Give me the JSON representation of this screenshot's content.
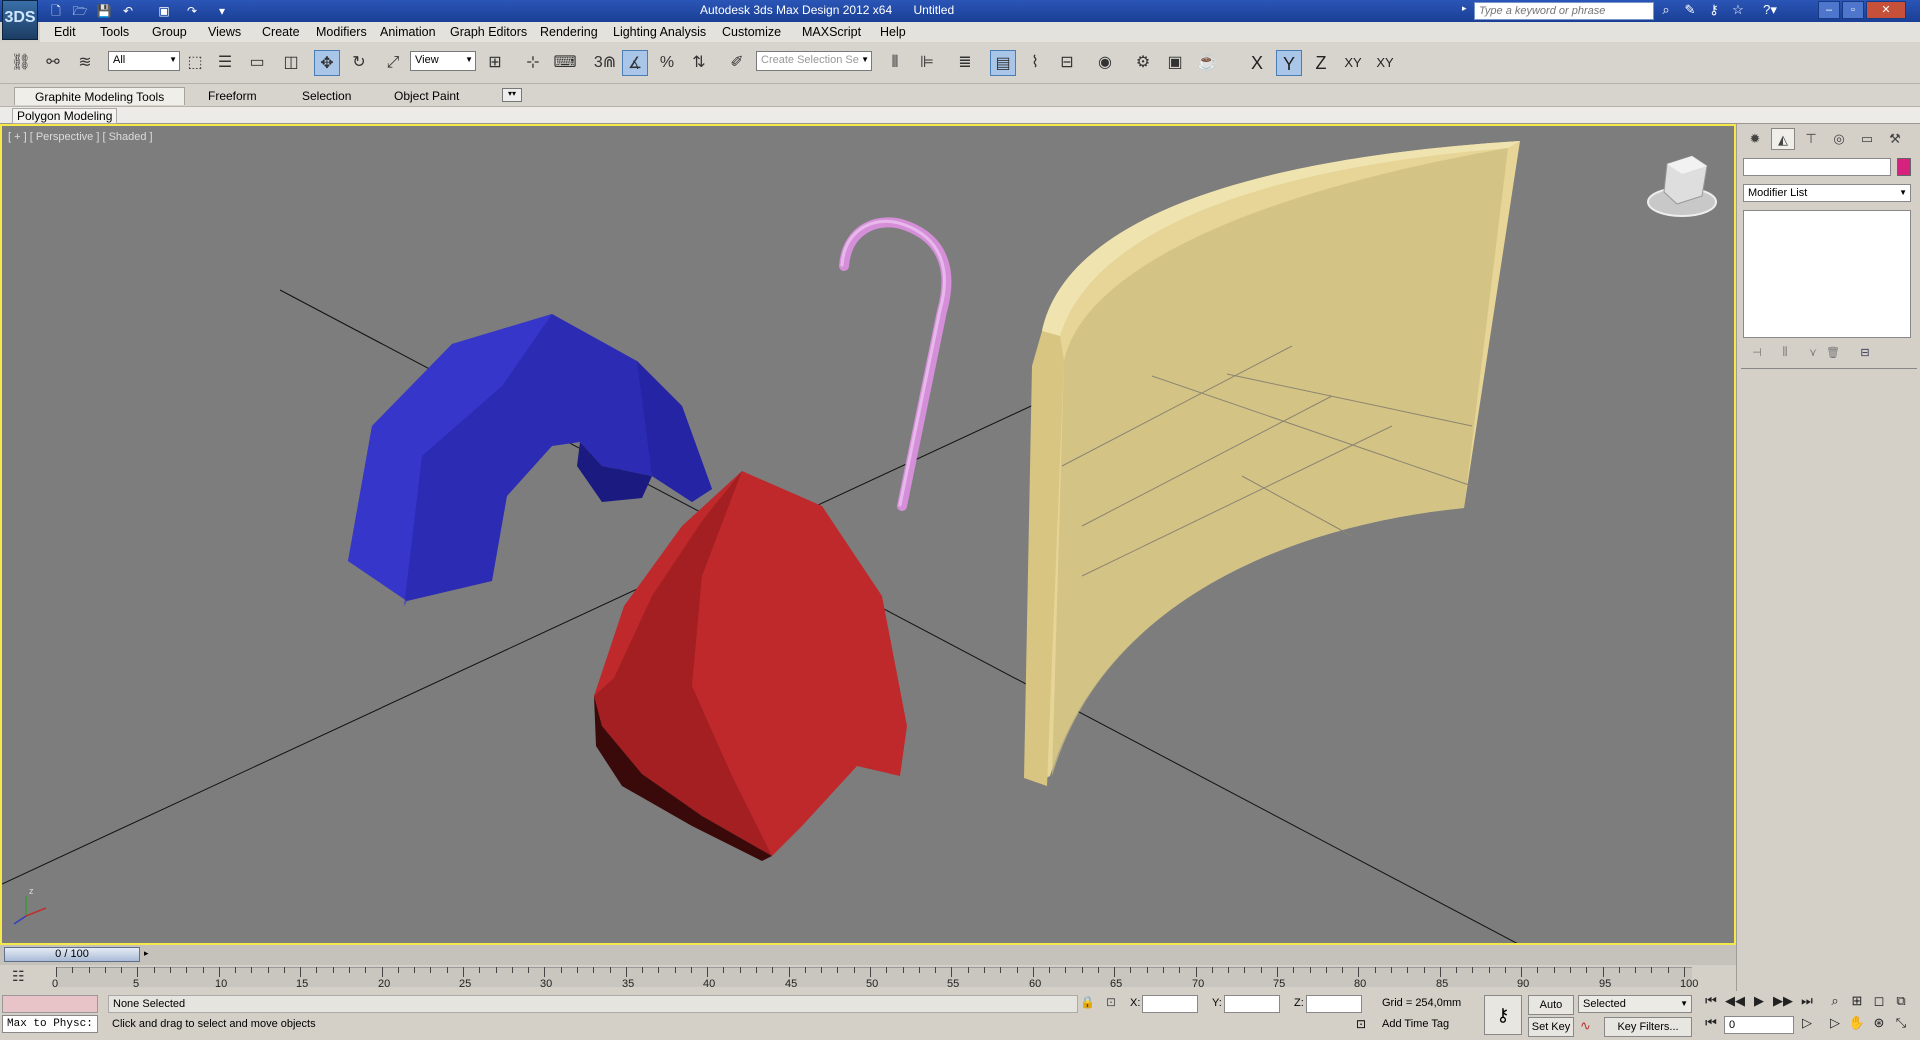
{
  "titlebar": {
    "app_logo": "3DS",
    "app_name": "Autodesk 3ds Max Design 2012 x64",
    "doc_name": "Untitled",
    "search_placeholder": "Type a keyword or phrase"
  },
  "menu": [
    "Edit",
    "Tools",
    "Group",
    "Views",
    "Create",
    "Modifiers",
    "Animation",
    "Graph Editors",
    "Rendering",
    "Lighting Analysis",
    "Customize",
    "MAXScript",
    "Help"
  ],
  "toolbar": {
    "filter_value": "All",
    "ref_coord_value": "View",
    "named_selection_placeholder": "Create Selection Se",
    "axis_x": "X",
    "axis_y": "Y",
    "axis_z": "Z",
    "axis_xy": "XY",
    "axis_xy2": "XY"
  },
  "ribbon": {
    "tabs": [
      "Graphite Modeling Tools",
      "Freeform",
      "Selection",
      "Object Paint"
    ],
    "sub_label": "Polygon Modeling"
  },
  "viewport": {
    "label": "[ + ] [ Perspective ] [ Shaded ]",
    "objects": {
      "blue": "#2c2bb4",
      "red": "#c0292c",
      "gold": "#e6d597",
      "pink": "#d48fd8"
    }
  },
  "command_panel": {
    "modifier_list": "Modifier List"
  },
  "timeline": {
    "frame_display": "0 / 100",
    "ticks": [
      "0",
      "5",
      "10",
      "15",
      "20",
      "25",
      "30",
      "35",
      "40",
      "45",
      "50",
      "55",
      "60",
      "65",
      "70",
      "75",
      "80",
      "85",
      "90",
      "95",
      "100"
    ]
  },
  "status": {
    "maxscript_listener": "Max to Physc:",
    "selection_status": "None Selected",
    "prompt": "Click and drag to select and move objects",
    "x_label": "X:",
    "y_label": "Y:",
    "z_label": "Z:",
    "grid": "Grid = 254,0mm",
    "add_time_tag": "Add Time Tag",
    "auto_key": "Auto Key",
    "set_key": "Set Key",
    "key_mode": "Selected",
    "key_filters": "Key Filters...",
    "current_frame": "0"
  }
}
